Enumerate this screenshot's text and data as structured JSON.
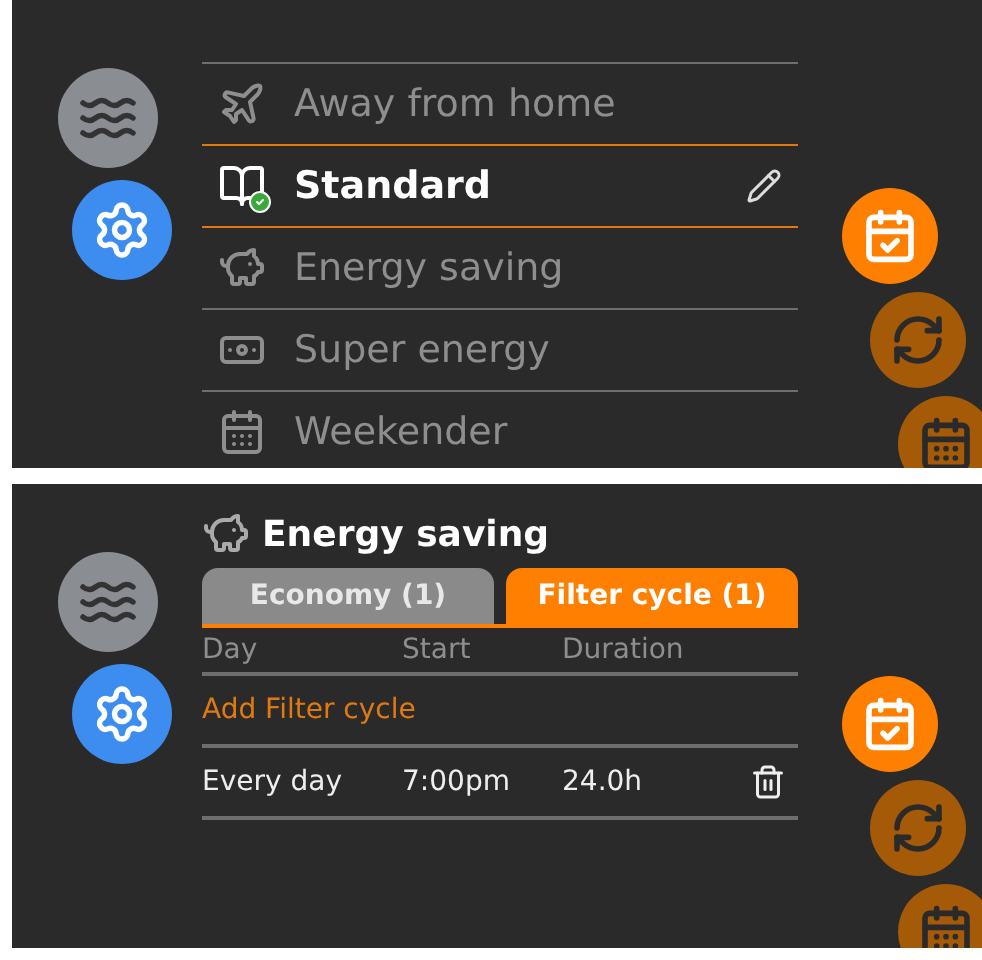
{
  "preset_screen": {
    "nav": [
      {
        "selected": false
      },
      {
        "selected": true
      }
    ],
    "presets": [
      {
        "label": "Away from home",
        "selected": false,
        "editable": false
      },
      {
        "label": "Standard",
        "selected": true,
        "editable": true
      },
      {
        "label": "Energy saving",
        "selected": false,
        "editable": false
      },
      {
        "label": "Super energy",
        "selected": false,
        "editable": false
      },
      {
        "label": "Weekender",
        "selected": false,
        "editable": false
      }
    ],
    "side_actions": [
      {
        "active": true
      },
      {
        "active": false
      },
      {
        "active": false
      }
    ]
  },
  "filter_screen": {
    "nav": [
      {
        "selected": false
      },
      {
        "selected": true
      }
    ],
    "title": "Energy saving",
    "tabs": [
      {
        "label": "Economy (1)",
        "selected": false
      },
      {
        "label": "Filter cycle (1)",
        "selected": true
      }
    ],
    "columns": [
      "Day",
      "Start",
      "Duration"
    ],
    "add_link": "Add Filter cycle",
    "rows": [
      {
        "day": "Every day",
        "start": "7:00pm",
        "duration": "24.0h"
      }
    ],
    "side_actions": [
      {
        "active": true
      },
      {
        "active": false
      },
      {
        "active": false
      }
    ]
  }
}
